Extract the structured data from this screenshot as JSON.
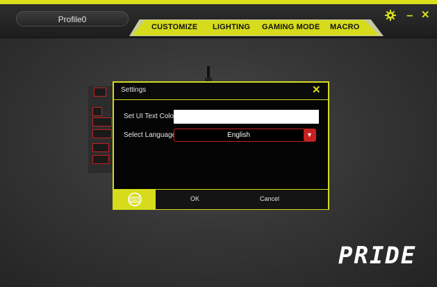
{
  "app": {
    "profile_name": "Profile0",
    "brand_text": "PRIDE",
    "accent_color": "#d6dc1c",
    "alert_color": "#c62020"
  },
  "tabs": [
    {
      "label": "CUSTOMIZE"
    },
    {
      "label": "LIGHTING"
    },
    {
      "label": "GAMING MODE"
    },
    {
      "label": "MACRO"
    }
  ],
  "window_controls": {
    "settings_icon": "gear-icon",
    "minimize_glyph": "–",
    "close_glyph": "✕"
  },
  "dialog": {
    "title": "Settings",
    "close_glyph": "✕",
    "ui_text_color_label": "Set UI Text Color",
    "ui_text_color_value": "",
    "language_label": "Select Language",
    "language_value": "English",
    "dropdown_glyph": "▼",
    "ok_label": "OK",
    "cancel_label": "Cancel",
    "footer_icon": "keyboard-refresh-icon"
  }
}
